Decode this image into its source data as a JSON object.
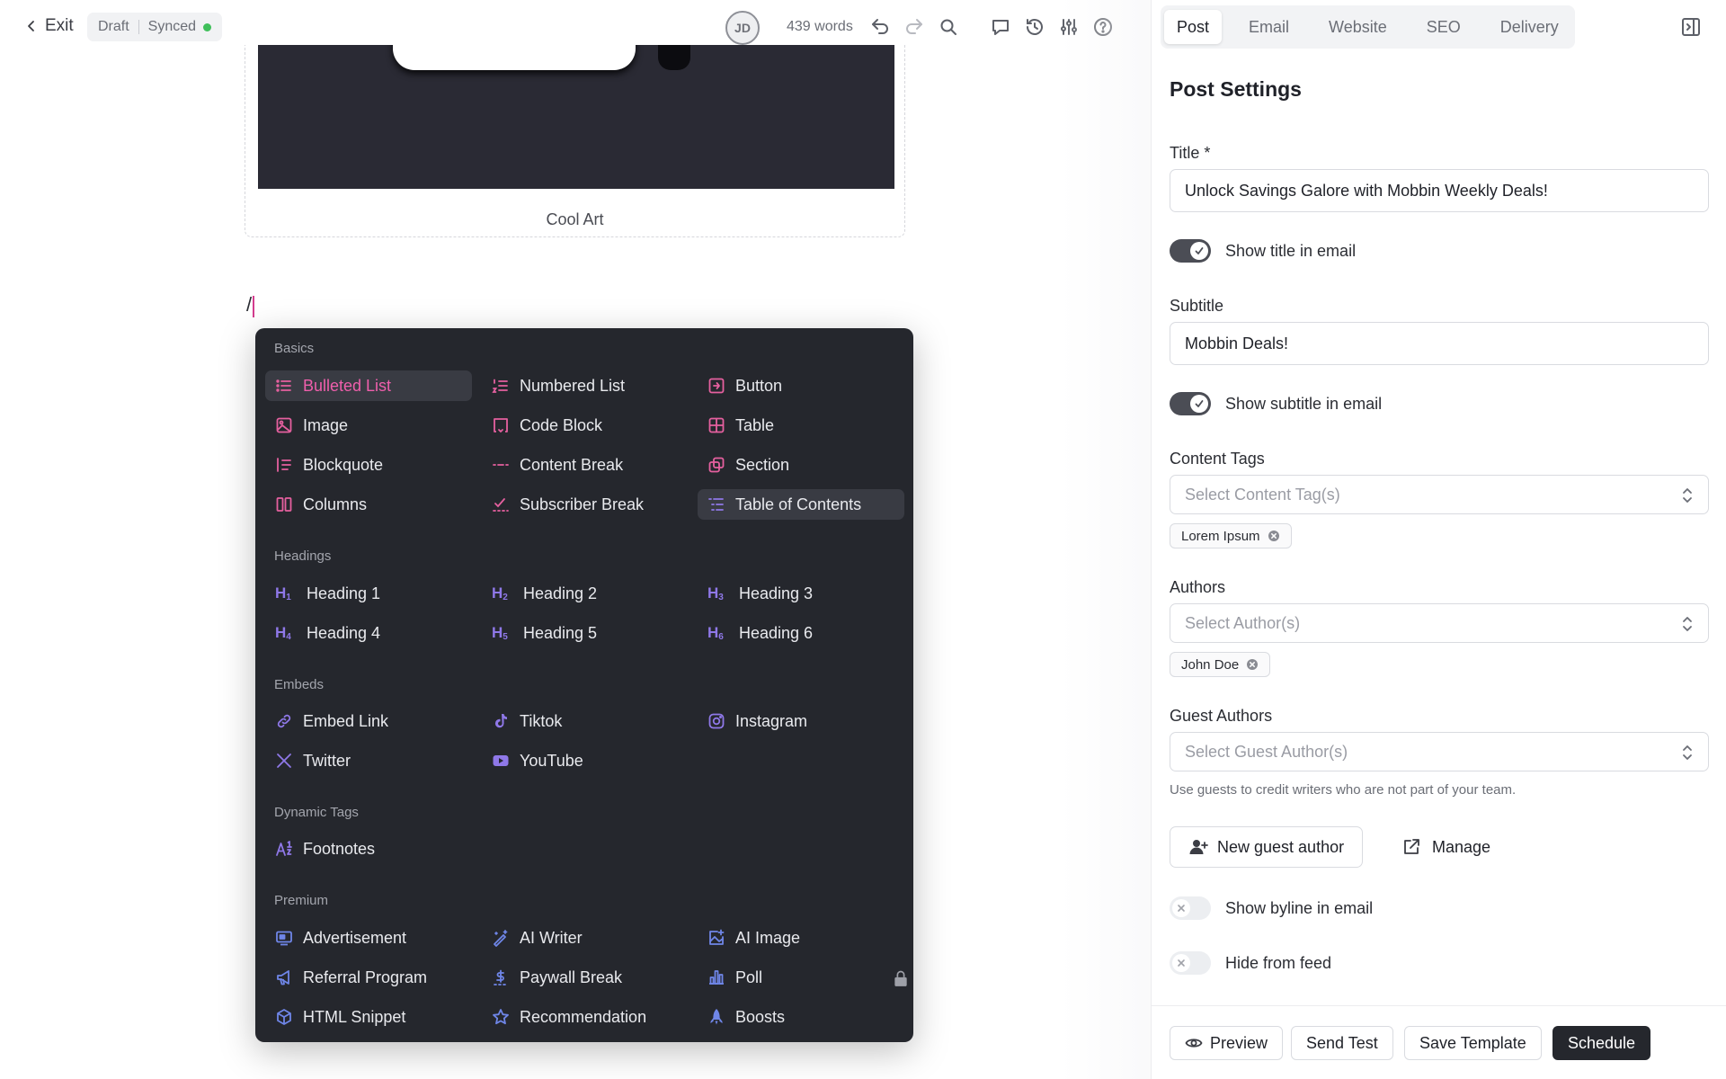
{
  "toolbar": {
    "exit_label": "Exit",
    "status_draft": "Draft",
    "status_synced": "Synced",
    "avatar_initials": "JD",
    "word_count": "439 words"
  },
  "editor": {
    "figure_caption": "Cool Art",
    "slash_text": "/"
  },
  "menu": {
    "basics_label": "Basics",
    "basics": [
      "Bulleted List",
      "Numbered List",
      "Button",
      "Image",
      "Code Block",
      "Table",
      "Blockquote",
      "Content Break",
      "Section",
      "Columns",
      "Subscriber Break",
      "Table of Contents"
    ],
    "headings_label": "Headings",
    "headings": [
      "Heading 1",
      "Heading 2",
      "Heading 3",
      "Heading 4",
      "Heading 5",
      "Heading 6"
    ],
    "embeds_label": "Embeds",
    "embeds": [
      "Embed Link",
      "Tiktok",
      "Instagram",
      "Twitter",
      "YouTube"
    ],
    "dynamic_label": "Dynamic Tags",
    "dynamic": [
      "Footnotes"
    ],
    "premium_label": "Premium",
    "premium": [
      "Advertisement",
      "AI Writer",
      "AI Image",
      "Referral Program",
      "Paywall Break",
      "Poll",
      "HTML Snippet",
      "Recommendation",
      "Boosts"
    ]
  },
  "panel": {
    "tabs": [
      "Post",
      "Email",
      "Website",
      "SEO",
      "Delivery"
    ],
    "active_tab": "Post",
    "title": "Post Settings",
    "title_label": "Title *",
    "title_value": "Unlock Savings Galore with Mobbin Weekly Deals!",
    "show_title_label": "Show title in email",
    "show_title_on": true,
    "subtitle_label": "Subtitle",
    "subtitle_value": "Mobbin Deals!",
    "show_subtitle_label": "Show subtitle in email",
    "show_subtitle_on": true,
    "content_tags_label": "Content Tags",
    "content_tags_placeholder": "Select Content Tag(s)",
    "content_tag_chip": "Lorem Ipsum",
    "authors_label": "Authors",
    "authors_placeholder": "Select Author(s)",
    "author_chip": "John Doe",
    "guest_authors_label": "Guest Authors",
    "guest_authors_placeholder": "Select Guest Author(s)",
    "guest_help": "Use guests to credit writers who are not part of your team.",
    "new_guest_label": "New guest author",
    "manage_label": "Manage",
    "show_byline_label": "Show byline in email",
    "show_byline_on": false,
    "hide_feed_label": "Hide from feed",
    "hide_feed_on": false
  },
  "footer": {
    "preview": "Preview",
    "send_test": "Send Test",
    "save_template": "Save Template",
    "schedule": "Schedule"
  },
  "colors": {
    "menu_bg": "#25272d",
    "accent_pink": "#ef5fac",
    "icon_violet": "#8f78e8",
    "icon_blue": "#6f86e8",
    "synced_dot": "#3fbf5a",
    "primary_button": "#25272d"
  },
  "icons": [
    "chevron-left-icon",
    "undo-icon",
    "redo-icon",
    "search-icon",
    "comment-icon",
    "history-icon",
    "sliders-icon",
    "help-icon",
    "panel-collapse-icon",
    "chevron-updown-icon",
    "close-circle-icon",
    "user-plus-icon",
    "external-link-icon",
    "eye-icon",
    "check-icon",
    "x-icon",
    "lock-icon"
  ]
}
